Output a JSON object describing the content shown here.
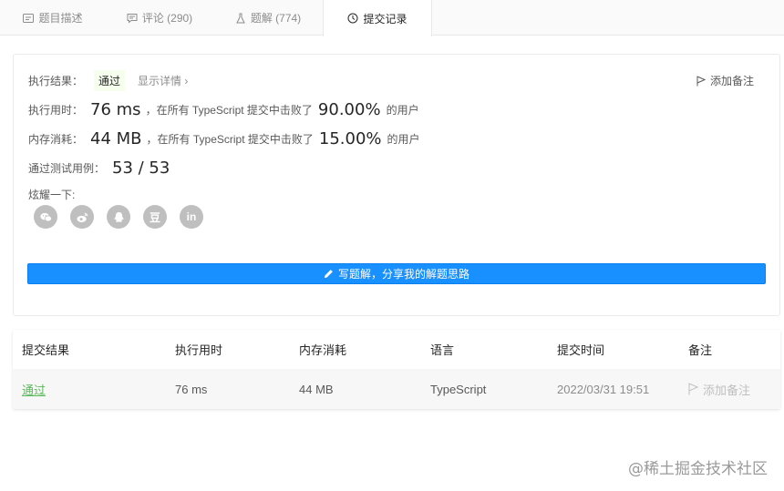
{
  "tabs": [
    {
      "label": "题目描述",
      "icon": "description-icon"
    },
    {
      "label": "评论 (290)",
      "icon": "comment-icon"
    },
    {
      "label": "题解 (774)",
      "icon": "flask-icon"
    },
    {
      "label": "提交记录",
      "icon": "clock-icon",
      "active": true
    }
  ],
  "result": {
    "status_label": "执行结果：",
    "status_value": "通过",
    "detail_link": "显示详情 ›",
    "add_note": "添加备注",
    "runtime_label": "执行用时：",
    "runtime_value": "76 ms",
    "runtime_mid": "，在所有 TypeScript 提交中击败了",
    "runtime_pct": "90.00%",
    "runtime_suffix": "的用户",
    "memory_label": "内存消耗：",
    "memory_value": "44 MB",
    "memory_mid": "，在所有 TypeScript 提交中击败了",
    "memory_pct": "15.00%",
    "memory_suffix": "的用户",
    "tests_label": "通过测试用例：",
    "tests_value": "53 / 53",
    "share_label": "炫耀一下:",
    "share_icons": [
      "wechat-icon",
      "weibo-icon",
      "qq-icon",
      "douban-icon",
      "linkedin-icon"
    ],
    "douban_glyph": "豆",
    "linkedin_glyph": "in",
    "write_button": "写题解，分享我的解题思路"
  },
  "table": {
    "headers": [
      "提交结果",
      "执行用时",
      "内存消耗",
      "语言",
      "提交时间",
      "备注"
    ],
    "rows": [
      {
        "result": "通过",
        "runtime": "76 ms",
        "memory": "44 MB",
        "language": "TypeScript",
        "time": "2022/03/31 19:51",
        "note": "添加备注"
      }
    ]
  },
  "watermark": "@稀土掘金技术社区",
  "colors": {
    "accent": "#1890ff",
    "pass": "#5cb85c",
    "pass_tag_bg": "#f6ffed",
    "icon_gray": "#bfbfbf"
  }
}
